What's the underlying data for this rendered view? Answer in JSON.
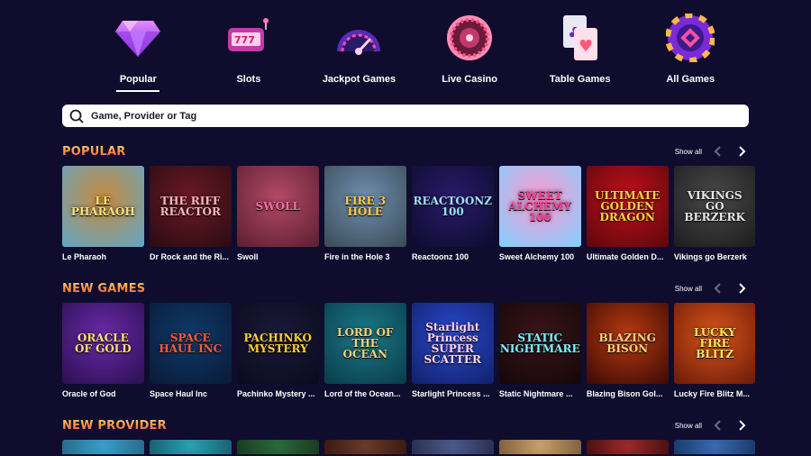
{
  "nav": [
    {
      "label": "Popular",
      "icon": "diamond-icon",
      "active": true
    },
    {
      "label": "Slots",
      "icon": "slot-machine-icon",
      "active": false
    },
    {
      "label": "Jackpot Games",
      "icon": "jackpot-gauge-icon",
      "active": false
    },
    {
      "label": "Live Casino",
      "icon": "roulette-icon",
      "active": false
    },
    {
      "label": "Table Games",
      "icon": "playing-cards-icon",
      "active": false
    },
    {
      "label": "All Games",
      "icon": "casino-chip-icon",
      "active": false
    }
  ],
  "search": {
    "placeholder": "Game, Provider or Tag"
  },
  "sections": {
    "popular": {
      "title": "POPULAR",
      "show_all": "Show all",
      "games": [
        {
          "name": "Le Pharaoh",
          "art": "LE PHARAOH",
          "bg": "#c98a3a",
          "bg2": "#5fa7c9",
          "fg": "#ffe27a"
        },
        {
          "name": "Dr Rock and the Ri...",
          "art": "THE RIFF REACTOR",
          "bg": "#6b1a24",
          "bg2": "#2a0b12",
          "fg": "#ffb4c0"
        },
        {
          "name": "Swoll",
          "art": "SWOLL",
          "bg": "#b44a67",
          "bg2": "#5a1e31",
          "fg": "#ff6aa0"
        },
        {
          "name": "Fire in the Hole 3",
          "art": "FIRE 3 HOLE",
          "bg": "#6f8fb0",
          "bg2": "#3a4a55",
          "fg": "#ffc94a"
        },
        {
          "name": "Reactoonz 100",
          "art": "REACTOONZ 100",
          "bg": "#2a1b6a",
          "bg2": "#0d0b2e",
          "fg": "#9ee0ff"
        },
        {
          "name": "Sweet Alchemy 100",
          "art": "SWEET ALCHEMY 100",
          "bg": "#ff9ad0",
          "bg2": "#7fd0ff",
          "fg": "#ff3f9a"
        },
        {
          "name": "Ultimate Golden D...",
          "art": "ULTIMATE GOLDEN DRAGON",
          "bg": "#c2101b",
          "bg2": "#5c070c",
          "fg": "#ffd34a"
        },
        {
          "name": "Vikings go Berzerk",
          "art": "VIKINGS GO BERZERK",
          "bg": "#4a4a4a",
          "bg2": "#1c1c1c",
          "fg": "#e8e8e8"
        }
      ]
    },
    "new_games": {
      "title": "NEW GAMES",
      "show_all": "Show all",
      "games": [
        {
          "name": "Oracle of God",
          "art": "ORACLE OF GOLD",
          "bg": "#6a2aa8",
          "bg2": "#2a0f52",
          "fg": "#ffe07a"
        },
        {
          "name": "Space Haul Inc",
          "art": "SPACE HAUL INC",
          "bg": "#0e3a6a",
          "bg2": "#0a1a36",
          "fg": "#ff5a3a"
        },
        {
          "name": "Pachinko Mystery ...",
          "art": "PACHINKO MYSTERY",
          "bg": "#1a1a3a",
          "bg2": "#0a0a1e",
          "fg": "#ffcf3a"
        },
        {
          "name": "Lord of the Ocean...",
          "art": "LORD OF THE OCEAN",
          "bg": "#1a7a8a",
          "bg2": "#0a3a48",
          "fg": "#f2d27a"
        },
        {
          "name": "Starlight Princess ...",
          "art": "Starlight Princess SUPER SCATTER",
          "bg": "#2a4acf",
          "bg2": "#11206a",
          "fg": "#ffd2f2"
        },
        {
          "name": "Static Nightmare ...",
          "art": "STATIC NIGHTMARE",
          "bg": "#3a1418",
          "bg2": "#14070a",
          "fg": "#7af2ff"
        },
        {
          "name": "Blazing Bison Gol...",
          "art": "BLAZING BISON",
          "bg": "#b83a10",
          "bg2": "#3a0a05",
          "fg": "#ffd27a"
        },
        {
          "name": "Lucky Fire Blitz M...",
          "art": "LUCKY FIRE BLITZ",
          "bg": "#d8541a",
          "bg2": "#6a1a08",
          "fg": "#ffe95a"
        }
      ]
    },
    "new_provider": {
      "title": "NEW PROVIDER",
      "show_all": "Show all",
      "games": [
        {
          "bg": "#3a9ec9",
          "bg2": "#2a6a8a"
        },
        {
          "bg": "#2aa0b0",
          "bg2": "#1a6070"
        },
        {
          "bg": "#2a6a3a",
          "bg2": "#1a3a20"
        },
        {
          "bg": "#6a3a2a",
          "bg2": "#3a1a10"
        },
        {
          "bg": "#4a5a8a",
          "bg2": "#2a3050"
        },
        {
          "bg": "#c8a06a",
          "bg2": "#806040"
        },
        {
          "bg": "#9a2a2a",
          "bg2": "#4a1010"
        },
        {
          "bg": "#3a6ab0",
          "bg2": "#1a3a6a"
        }
      ]
    }
  }
}
